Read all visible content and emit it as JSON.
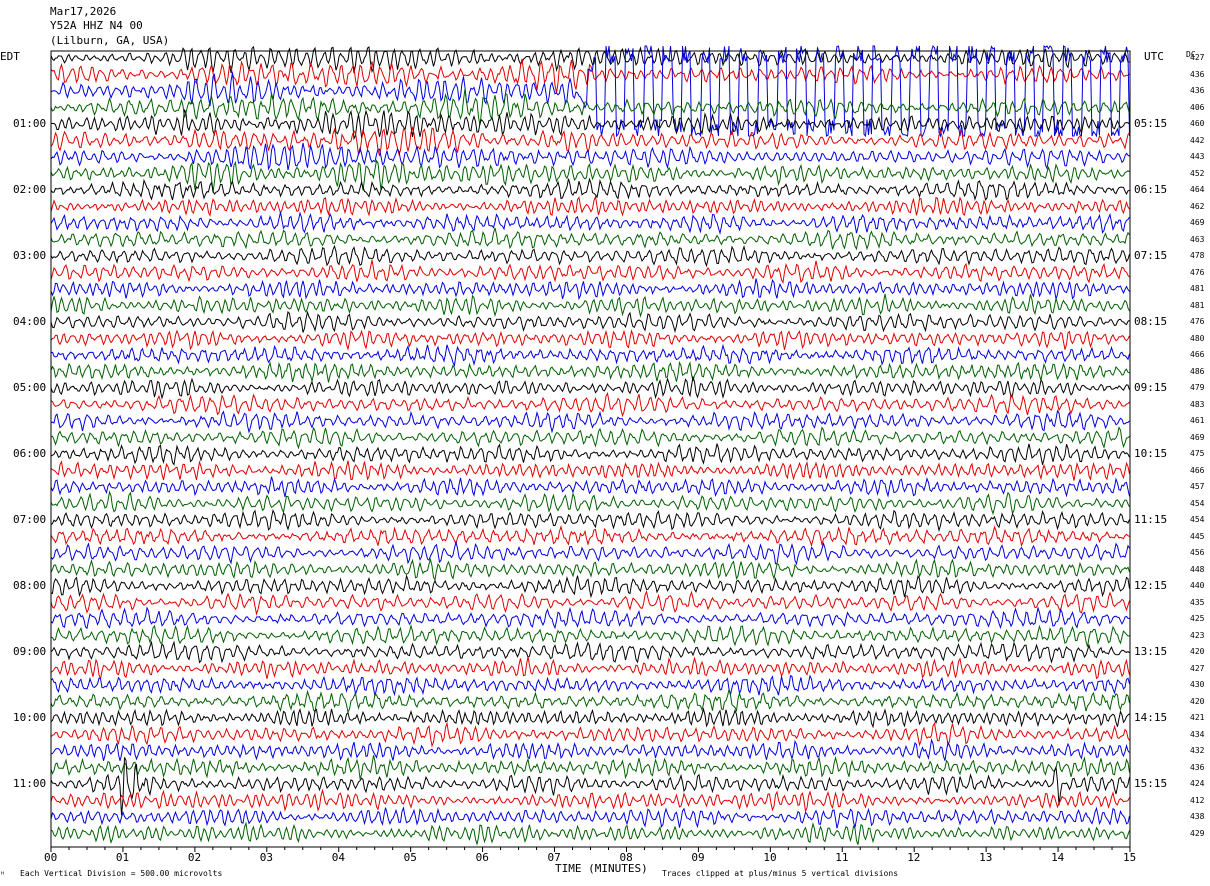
{
  "header": {
    "date": "Mar17,2026",
    "station": "Y52A HHZ N4 00",
    "location": "(Lilburn, GA, USA)"
  },
  "axes": {
    "left_tz": "EDT",
    "right_tz": "UTC",
    "dc_label": "DC",
    "xlabel": "TIME (MINUTES)"
  },
  "footer": {
    "scale_note": "Each Vertical Division =  500.00 microvolts",
    "clip_note": "Traces clipped at plus/minus 5 vertical divisions"
  },
  "colors": {
    "cycle": [
      "#000000",
      "#e00000",
      "#0000e0",
      "#006000"
    ],
    "frame": "#000000"
  },
  "chart_data": {
    "type": "line",
    "title": "",
    "x_ticks": [
      "00",
      "01",
      "02",
      "03",
      "04",
      "05",
      "06",
      "07",
      "08",
      "09",
      "10",
      "11",
      "12",
      "13",
      "14",
      "15"
    ],
    "xlim": [
      0,
      15
    ],
    "x_unit_minutes_per_trace": 15,
    "left_hour_labels": [
      "01:00",
      "02:00",
      "03:00",
      "04:00",
      "05:00",
      "06:00",
      "07:00",
      "08:00",
      "09:00",
      "10:00",
      "11:00"
    ],
    "right_hour_labels": [
      "05:15",
      "06:15",
      "07:15",
      "08:15",
      "09:15",
      "10:15",
      "11:15",
      "12:15",
      "13:15",
      "14:15",
      "15:15"
    ],
    "trace_count": 48,
    "dc_offsets": [
      427,
      436,
      436,
      406,
      460,
      442,
      443,
      452,
      464,
      462,
      469,
      463,
      478,
      476,
      481,
      481,
      476,
      480,
      466,
      486,
      479,
      483,
      461,
      469,
      475,
      466,
      457,
      454,
      454,
      445,
      456,
      448,
      440,
      435,
      425,
      423,
      420,
      427,
      430,
      420,
      421,
      434,
      432,
      436,
      424,
      412,
      438,
      429
    ],
    "clip_divisions": 5,
    "events": [
      {
        "trace": 2,
        "minute_start": 7.3,
        "minute_end": 15,
        "note": "clipped noise burst"
      },
      {
        "trace": 44,
        "minute": 1.0,
        "note": "spike"
      },
      {
        "trace": 44,
        "minute": 7.7,
        "note": "spike"
      },
      {
        "trace": 44,
        "minute": 14.0,
        "note": "spike"
      }
    ]
  }
}
